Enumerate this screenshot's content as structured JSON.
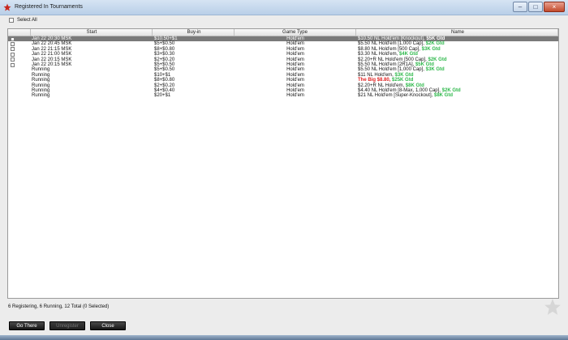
{
  "window": {
    "title": "Registered In Tournaments"
  },
  "select_all_label": "Select All",
  "columns": [
    "",
    "Start",
    "Buy-in",
    "Game Type",
    "Name"
  ],
  "rows": [
    {
      "checkbox": true,
      "selected": true,
      "start": "Jan 22  20:30 MSK",
      "buyin": "$10.50+$1",
      "game": "Hold'em",
      "name": "$10.50 NL Hold'em [Knockout],",
      "gtd": "$5K Gtd",
      "red_name": ""
    },
    {
      "checkbox": true,
      "selected": false,
      "start": "Jan 22  20:45 MSK",
      "buyin": "$5+$0.50",
      "game": "Hold'em",
      "name": "$5.50 NL Hold'em [1,000 Cap],",
      "gtd": "$2K Gtd",
      "red_name": ""
    },
    {
      "checkbox": true,
      "selected": false,
      "start": "Jan 22  21:15 MSK",
      "buyin": "$8+$0.80",
      "game": "Hold'em",
      "name": "$8.80 NL Hold'em [500 Cap],",
      "gtd": "$3K Gtd",
      "red_name": ""
    },
    {
      "checkbox": true,
      "selected": false,
      "start": "Jan 22  21:00 MSK",
      "buyin": "$3+$0.30",
      "game": "Hold'em",
      "name": "$3.30 NL Hold'em,",
      "gtd": "$4K Gtd",
      "red_name": ""
    },
    {
      "checkbox": true,
      "selected": false,
      "start": "Jan 22  20:15 MSK",
      "buyin": "$2+$0.20",
      "game": "Hold'em",
      "name": "$2.20+R NL Hold'em [500 Cap],",
      "gtd": "$2K Gtd",
      "red_name": ""
    },
    {
      "checkbox": true,
      "selected": false,
      "start": "Jan 22  20:15 MSK",
      "buyin": "$5+$0.50",
      "game": "Hold'em",
      "name": "$5.50 NL Hold'em [2R1A],",
      "gtd": "$5K Gtd",
      "red_name": ""
    },
    {
      "checkbox": false,
      "selected": false,
      "start": "Running",
      "buyin": "$5+$0.50",
      "game": "Hold'em",
      "name": "$5.50 NL Hold'em [1,000 Cap],",
      "gtd": "$3K Gtd",
      "red_name": ""
    },
    {
      "checkbox": false,
      "selected": false,
      "start": "Running",
      "buyin": "$10+$1",
      "game": "Hold'em",
      "name": "$11 NL Hold'em,",
      "gtd": "$3K Gtd",
      "red_name": ""
    },
    {
      "checkbox": false,
      "selected": false,
      "start": "Running",
      "buyin": "$8+$0.80",
      "game": "Hold'em",
      "name": "",
      "gtd": "$25K Gtd",
      "red_name": "The Big $8.80,"
    },
    {
      "checkbox": false,
      "selected": false,
      "start": "Running",
      "buyin": "$2+$0.20",
      "game": "Hold'em",
      "name": "$2.20+R NL Hold'em,",
      "gtd": "$8K Gtd",
      "red_name": ""
    },
    {
      "checkbox": false,
      "selected": false,
      "start": "Running",
      "buyin": "$4+$0.40",
      "game": "Hold'em",
      "name": "$4.40 NL Hold'em [8-Max, 1,000 Cap],",
      "gtd": "$2K Gtd",
      "red_name": ""
    },
    {
      "checkbox": false,
      "selected": false,
      "start": "Running",
      "buyin": "$20+$1",
      "game": "Hold'em",
      "name": "$21 NL Hold'em [Super-Knockout],",
      "gtd": "$8K Gtd",
      "red_name": ""
    }
  ],
  "status_text": "6 Registering, 6 Running, 12 Total (0 Selected)",
  "buttons": {
    "go_there": "Go There",
    "unregister": "Unregister",
    "close": "Close"
  },
  "colors": {
    "gtd": "#2db84a",
    "red_name": "#e02020",
    "selected_row": "#7a7a7a"
  }
}
